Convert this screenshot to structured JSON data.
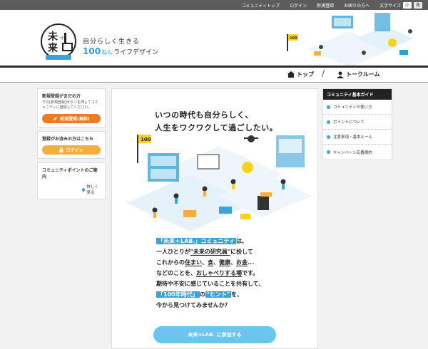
{
  "topnav": {
    "items": [
      "コミュニティトップ",
      "ログイン",
      "新規登録",
      "お困りの方へ"
    ],
    "font_size_label": "文字サイズ",
    "sizes": [
      "小",
      "大"
    ]
  },
  "header": {
    "logo_text": "未来+LAB.",
    "tagline1": "自分らしく生きる",
    "tagline2_num": "100",
    "tagline2_nen": "ねん",
    "tagline2_rest": "ライフデザイン",
    "flag_label": "100"
  },
  "nav": {
    "home": "トップ",
    "talk": "トークルーム"
  },
  "sidebar_left": {
    "register_title": "新規登録がまだの方",
    "register_desc": "下の[新規登録]ボタンを押してコミュニティに登録してください。",
    "register_button": "新規登録(無料)",
    "login_title": "登録がお済みの方はこちら",
    "login_button": "ログイン",
    "points_title": "コミュニティポイントのご案内",
    "points_more": "詳しく見る"
  },
  "main": {
    "headline1": "いつの時代も自分らしく、",
    "headline2": "人生をワクワクして過ごしたい。",
    "flag_label": "100",
    "body": {
      "l1_hl": "「未来＋LAB.」コミュニティ",
      "l1_rest": "は、",
      "l2_a": "一人ひとりが",
      "l2_hl": "\"未来の研究員\"",
      "l2_b": "に扮して",
      "l3_a": "これからの",
      "l3_u1": "住まい",
      "l3_c1": "、",
      "l3_u2": "食",
      "l3_c2": "、",
      "l3_u3": "健康",
      "l3_c3": "、",
      "l3_u4": "お金",
      "l3_c4": "...",
      "l4_a": "などのことを、",
      "l4_u": "おしゃべりする場",
      "l4_b": "です。",
      "l5": "期待や不安に感じていることを共有して、",
      "l6_hl1": "「100年時代」",
      "l6_m": "の",
      "l6_hl2": "\"ヒント\"",
      "l6_b": "を、",
      "l7": "今から見つけてみませんか？"
    },
    "join_button": "未来+LAB. に参加する"
  },
  "sidebar_right": {
    "title": "コミュニティ基本ガイド",
    "items": [
      "コミュニティの使い方",
      "ポイントについて",
      "注意事項・基本ルール",
      "キャンペーン応募規約"
    ]
  },
  "colors": {
    "accent_blue": "#3aa4da",
    "orange": "#ee7a22",
    "light_orange": "#f5ad3c",
    "yellow": "#f7d417"
  }
}
